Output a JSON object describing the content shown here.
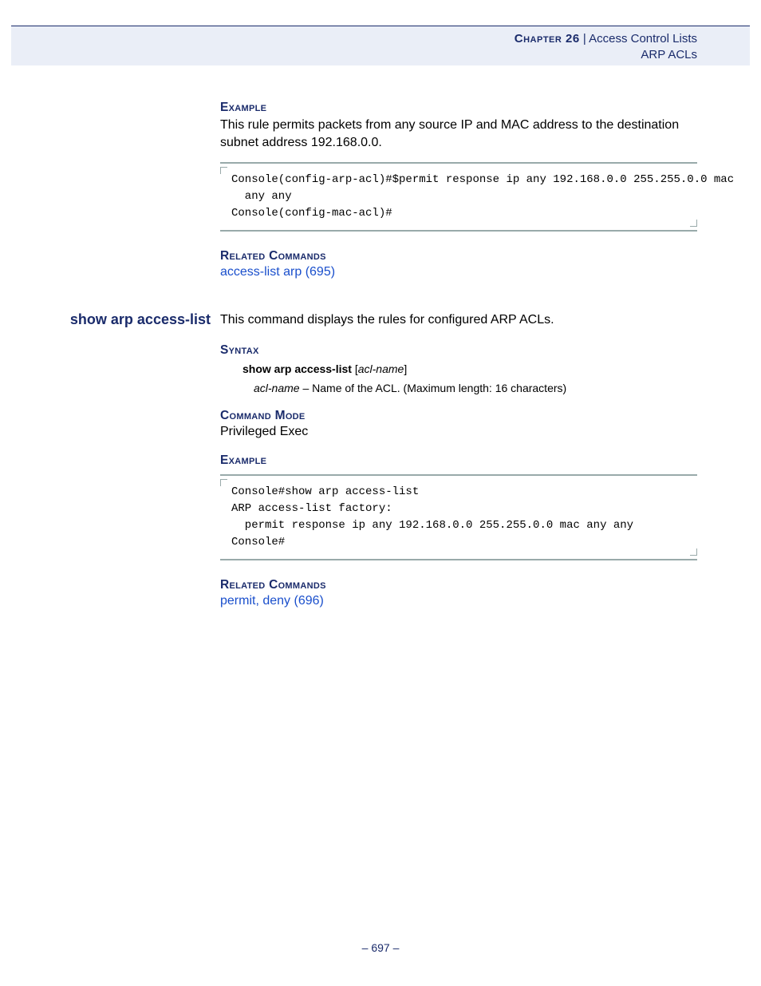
{
  "header": {
    "chapter_label": "Chapter 26",
    "sep": "  |  ",
    "title": "Access Control Lists",
    "sub": "ARP ACLs"
  },
  "section1": {
    "example_heading": "Example",
    "example_text": "This rule permits packets from any source IP and MAC address to the destination subnet address 192.168.0.0.",
    "code": "Console(config-arp-acl)#$permit response ip any 192.168.0.0 255.255.0.0 mac \n  any any\nConsole(config-mac-acl)#",
    "related_heading": "Related Commands",
    "related_link": "access-list arp (695)"
  },
  "cmd": {
    "name": "show arp access-list",
    "desc": "This command displays the rules for configured ARP ACLs."
  },
  "section2": {
    "syntax_heading": "Syntax",
    "syntax_bold": "show arp access-list",
    "syntax_bracket_open": " [",
    "syntax_ital": "acl-name",
    "syntax_bracket_close": "]",
    "param_ital": "acl-name",
    "param_rest": " – Name of the ACL. (Maximum length: 16 characters)",
    "mode_heading": "Command Mode",
    "mode_text": "Privileged Exec",
    "example_heading": "Example",
    "code": "Console#show arp access-list\nARP access-list factory:\n  permit response ip any 192.168.0.0 255.255.0.0 mac any any\nConsole#",
    "related_heading": "Related Commands",
    "related_link": "permit, deny (696)"
  },
  "page_num": "–  697  –"
}
